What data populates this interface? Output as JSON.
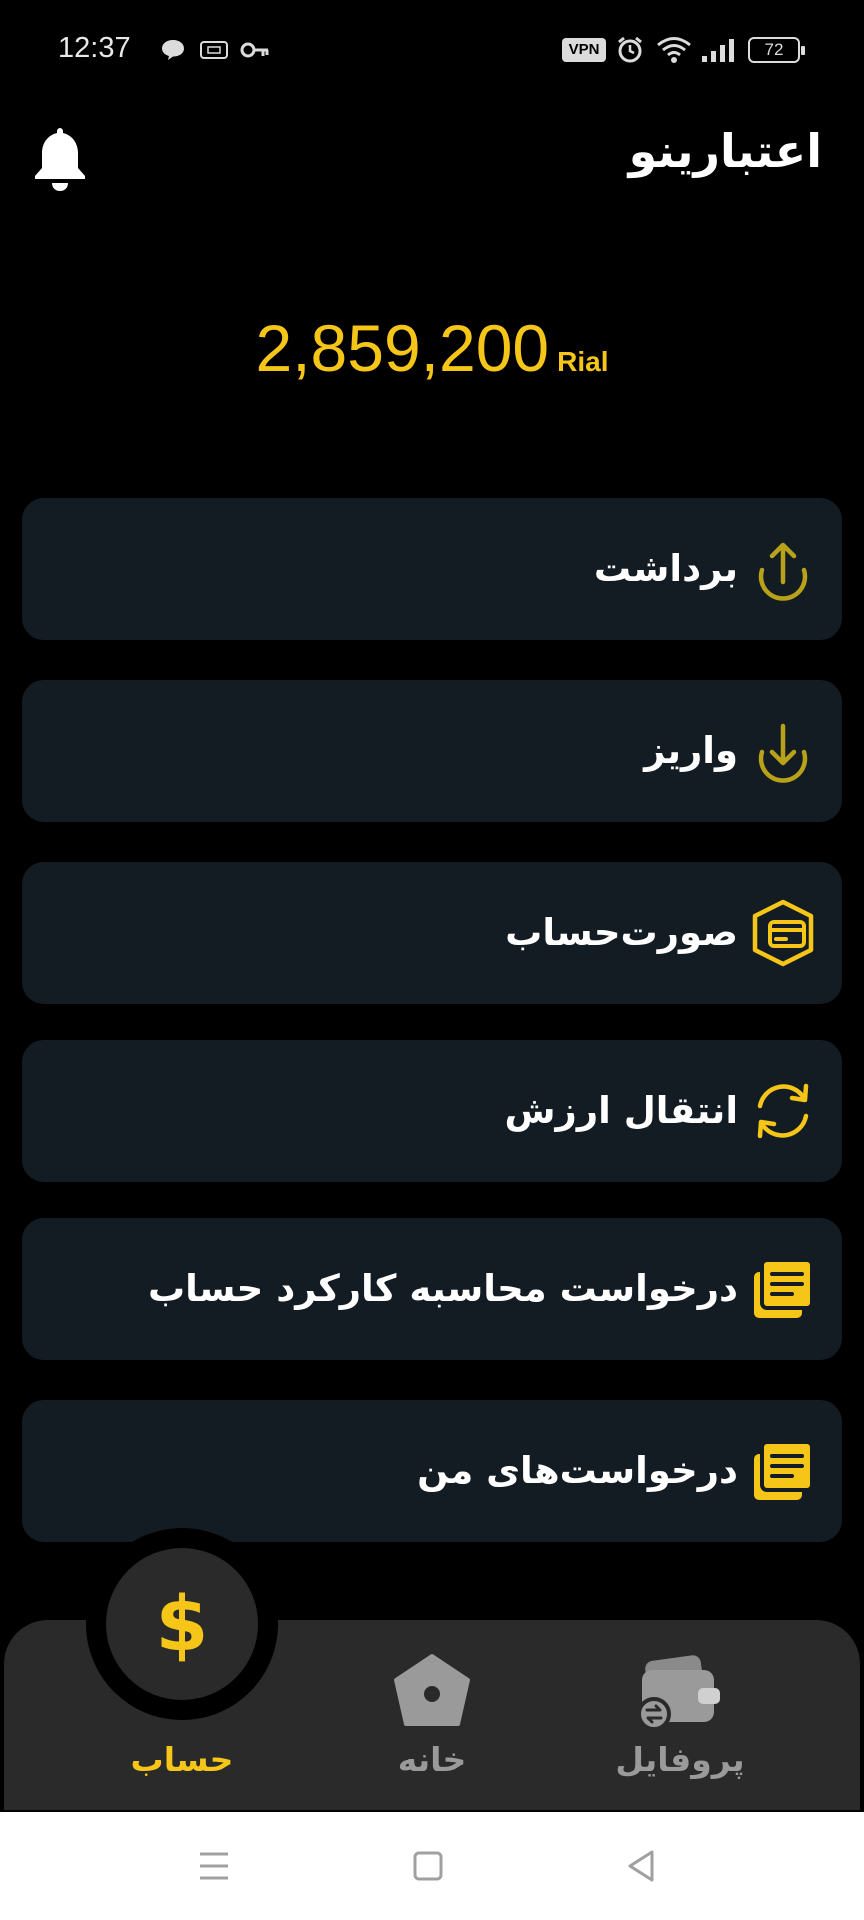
{
  "status_bar": {
    "time": "12:37",
    "vpn": "VPN",
    "battery": "72",
    "icons": [
      "chat-bubble-icon",
      "card-icon",
      "key-icon",
      "alarm-icon",
      "wifi-icon",
      "signal-icon"
    ]
  },
  "header": {
    "title": "اعتبارینو",
    "bell_icon": "bell-icon"
  },
  "balance": {
    "amount": "2,859,200",
    "unit": "Rial"
  },
  "menu": [
    {
      "label": "برداشت",
      "icon": "upload-arrow-icon"
    },
    {
      "label": "واریز",
      "icon": "download-arrow-icon"
    },
    {
      "label": "صورت‌حساب",
      "icon": "statement-card-icon"
    },
    {
      "label": "انتقال ارزش",
      "icon": "refresh-transfer-icon"
    },
    {
      "label": "درخواست محاسبه کارکرد حساب",
      "icon": "document-stack-icon"
    },
    {
      "label": "درخواست‌های من",
      "icon": "document-stack-icon"
    }
  ],
  "bottom_nav": {
    "account": {
      "label": "حساب",
      "icon": "dollar-icon",
      "glyph": "$",
      "active": true
    },
    "home": {
      "label": "خانه",
      "icon": "home-icon"
    },
    "profile": {
      "label": "پروفایل",
      "icon": "wallet-icon"
    }
  },
  "colors": {
    "accent": "#f5c518",
    "card": "#141c23",
    "nav": "#2a2a2a",
    "inactive": "#9a9a9a"
  },
  "system_nav": [
    "menu-icon",
    "home-square-icon",
    "back-triangle-icon"
  ]
}
